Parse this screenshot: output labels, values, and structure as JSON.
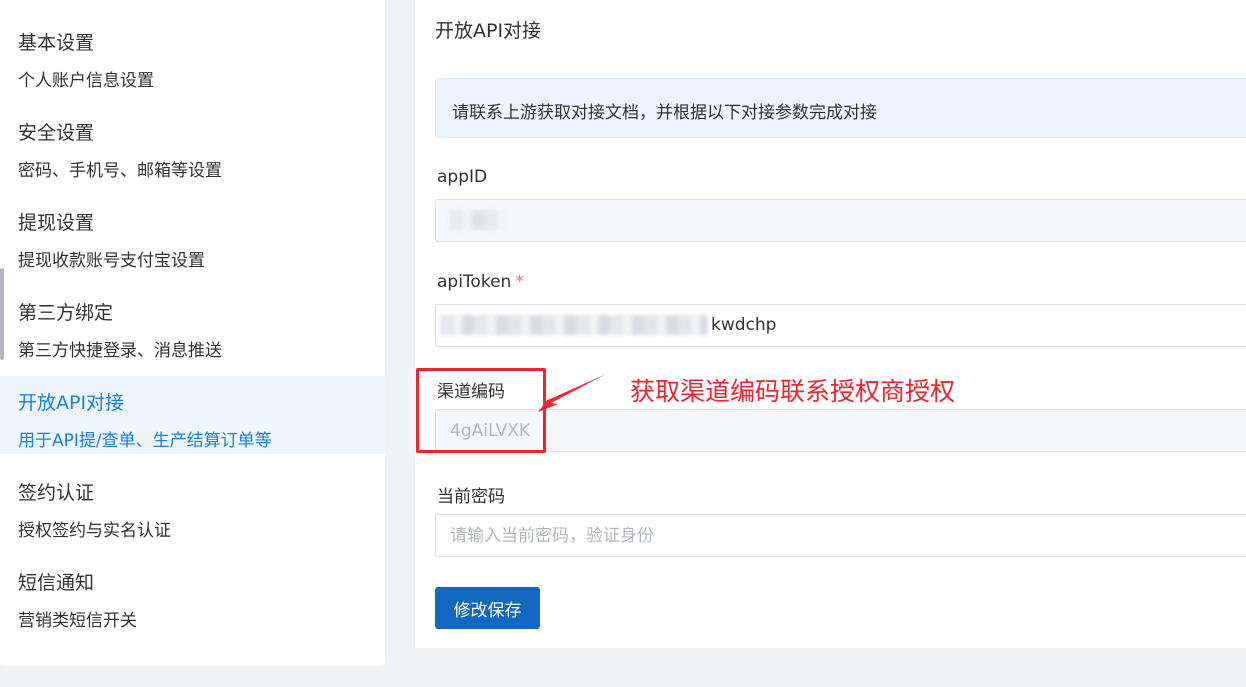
{
  "sidebar": {
    "items": [
      {
        "title": "基本设置",
        "desc": "个人账户信息设置"
      },
      {
        "title": "安全设置",
        "desc": "密码、手机号、邮箱等设置"
      },
      {
        "title": "提现设置",
        "desc": "提现收款账号支付宝设置"
      },
      {
        "title": "第三方绑定",
        "desc": "第三方快捷登录、消息推送"
      },
      {
        "title": "开放API对接",
        "desc": "用于API提/查单、生产结算订单等"
      },
      {
        "title": "签约认证",
        "desc": "授权签约与实名认证"
      },
      {
        "title": "短信通知",
        "desc": "营销类短信开关"
      }
    ],
    "active_index": 4
  },
  "main": {
    "title": "开放API对接",
    "info": "请联系上游获取对接文档，并根据以下对接参数完成对接",
    "fields": {
      "appid": {
        "label": "appID"
      },
      "apitoken": {
        "label": "apiToken",
        "required_mark": "*",
        "visible_tail": "kwdchp"
      },
      "channel_code": {
        "label": "渠道编码",
        "value": "4gAiLVXK"
      },
      "current_password": {
        "label": "当前密码",
        "placeholder": "请输入当前密码，验证身份"
      }
    },
    "save_label": "修改保存"
  },
  "annotation": {
    "text": "获取渠道编码联系授权商授权",
    "color": "#f5222d"
  },
  "colors": {
    "accent": "#1a7fe0",
    "button": "#1369c2",
    "info_bg": "#ecf5ff"
  }
}
